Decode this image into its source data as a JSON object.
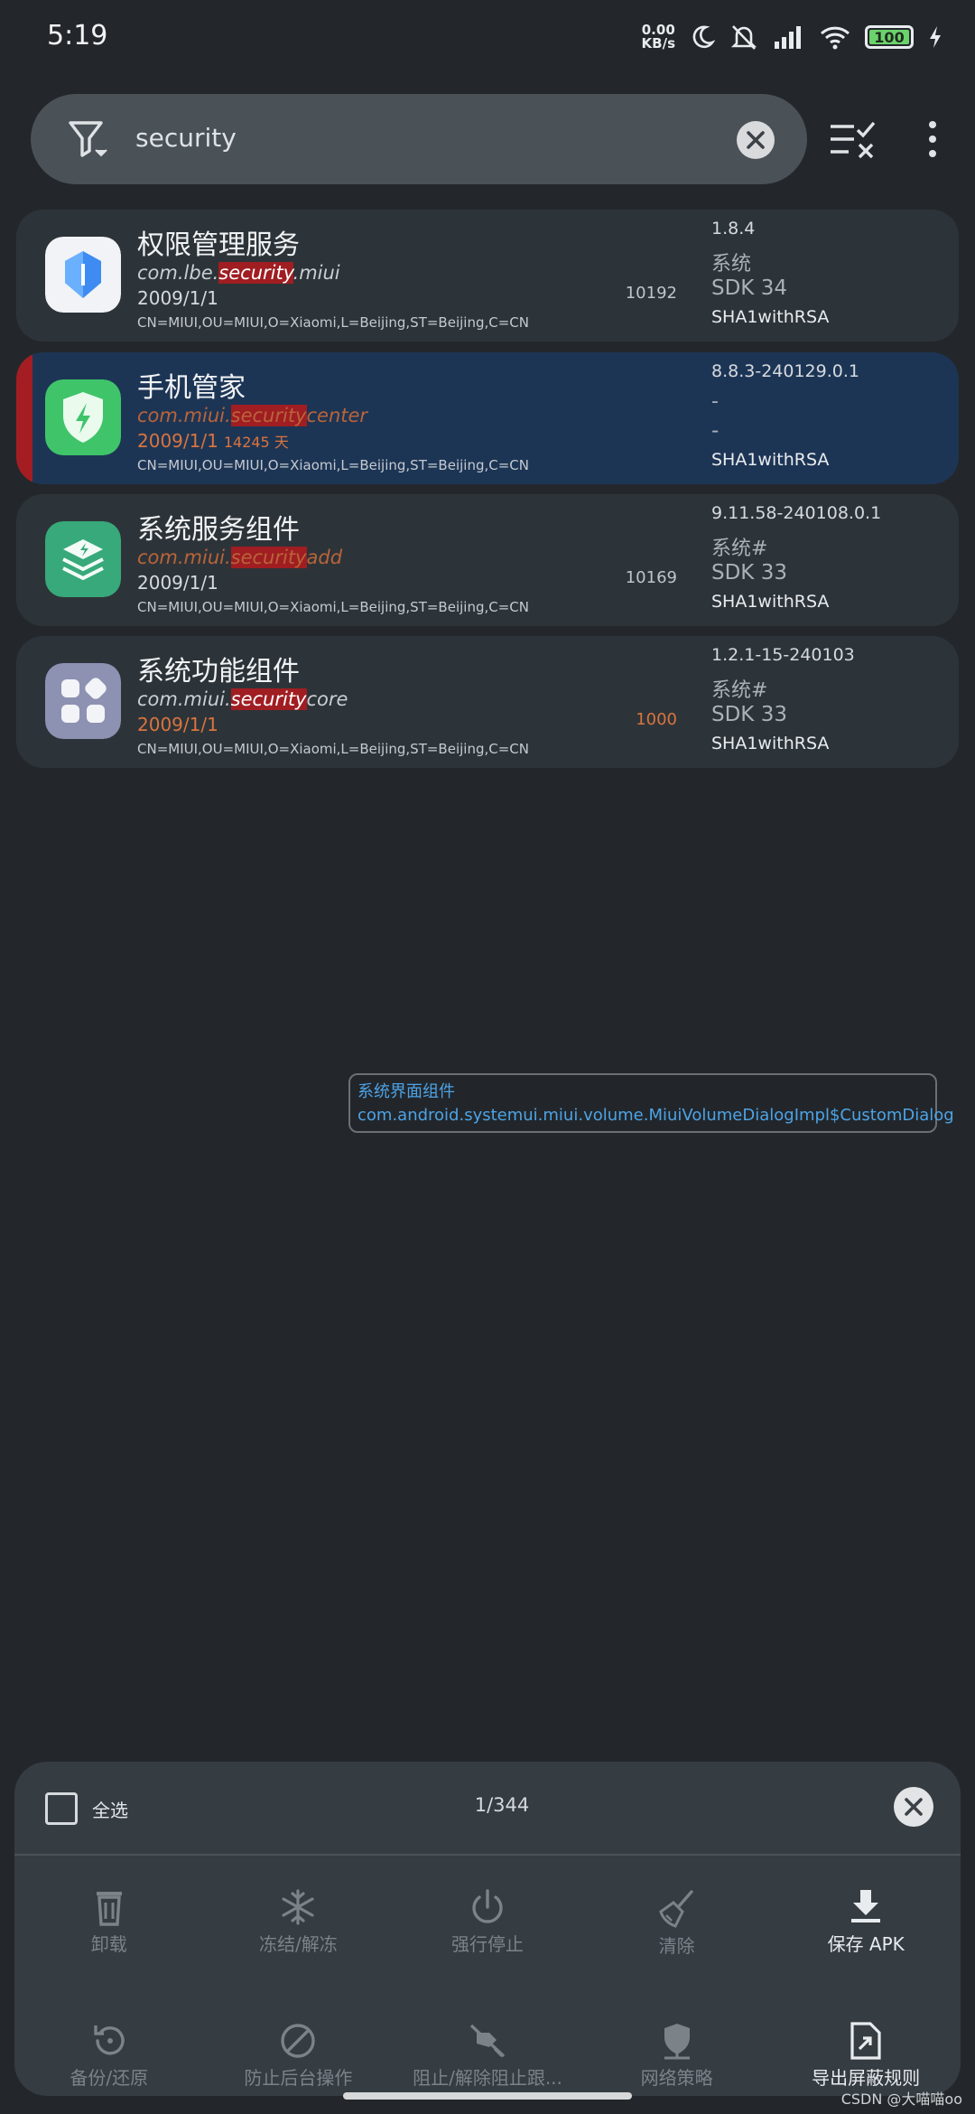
{
  "status_bar": {
    "time": "5:19",
    "net_speed_value": "0.00",
    "net_speed_unit": "KB/s",
    "battery": "100"
  },
  "search": {
    "query": "security"
  },
  "apps": [
    {
      "name": "权限管理服务",
      "pkg_prefix": "com.lbe.",
      "pkg_match": "security",
      "pkg_suffix": ".miui",
      "date": "2009/1/1",
      "days": "",
      "cert": "CN=MIUI,OU=MIUI,O=Xiaomi,L=Beijing,ST=Beijing,C=CN",
      "uid": "10192",
      "version": "1.8.4",
      "type": "系统",
      "sdk": "SDK 34",
      "signature": "SHA1withRSA"
    },
    {
      "name": "手机管家",
      "pkg_prefix": "com.miui.",
      "pkg_match": "security",
      "pkg_suffix": "center",
      "date": "2009/1/1",
      "days": "14245 天",
      "cert": "CN=MIUI,OU=MIUI,O=Xiaomi,L=Beijing,ST=Beijing,C=CN",
      "uid": "",
      "version": "8.8.3-240129.0.1",
      "type": "-",
      "sdk": "-",
      "signature": "SHA1withRSA"
    },
    {
      "name": "系统服务组件",
      "pkg_prefix": "com.miui.",
      "pkg_match": "security",
      "pkg_suffix": "add",
      "date": "2009/1/1",
      "days": "",
      "cert": "CN=MIUI,OU=MIUI,O=Xiaomi,L=Beijing,ST=Beijing,C=CN",
      "uid": "10169",
      "version": "9.11.58-240108.0.1",
      "type": "系统#",
      "sdk": "SDK 33",
      "signature": "SHA1withRSA"
    },
    {
      "name": "系统功能组件",
      "pkg_prefix": "com.miui.",
      "pkg_match": "security",
      "pkg_suffix": "core",
      "date": "2009/1/1",
      "days": "",
      "cert": "CN=MIUI,OU=MIUI,O=Xiaomi,L=Beijing,ST=Beijing,C=CN",
      "uid": "1000",
      "version": "1.2.1-15-240103",
      "type": "系统#",
      "sdk": "SDK 33",
      "signature": "SHA1withRSA"
    }
  ],
  "overlay": {
    "line1": "系统界面组件",
    "line2": "com.android.systemui.miui.volume.MiuiVolumeDialogImpl$CustomDialog"
  },
  "panel": {
    "select_all": "全选",
    "count": "1/344",
    "row1": [
      "卸载",
      "冻结/解冻",
      "强行停止",
      "清除",
      "保存 APK"
    ],
    "row2": [
      "备份/还原",
      "防止后台操作",
      "阻止/解除阻止跟...",
      "网络策略",
      "导出屏蔽规则"
    ]
  },
  "watermark": "CSDN @大喵喵oo",
  "colors": {
    "background": "#23272b",
    "selected_card": "#1d3555",
    "highlight": "#a01d22",
    "orange_text": "#d9743e",
    "link_blue": "#4da3e6"
  }
}
